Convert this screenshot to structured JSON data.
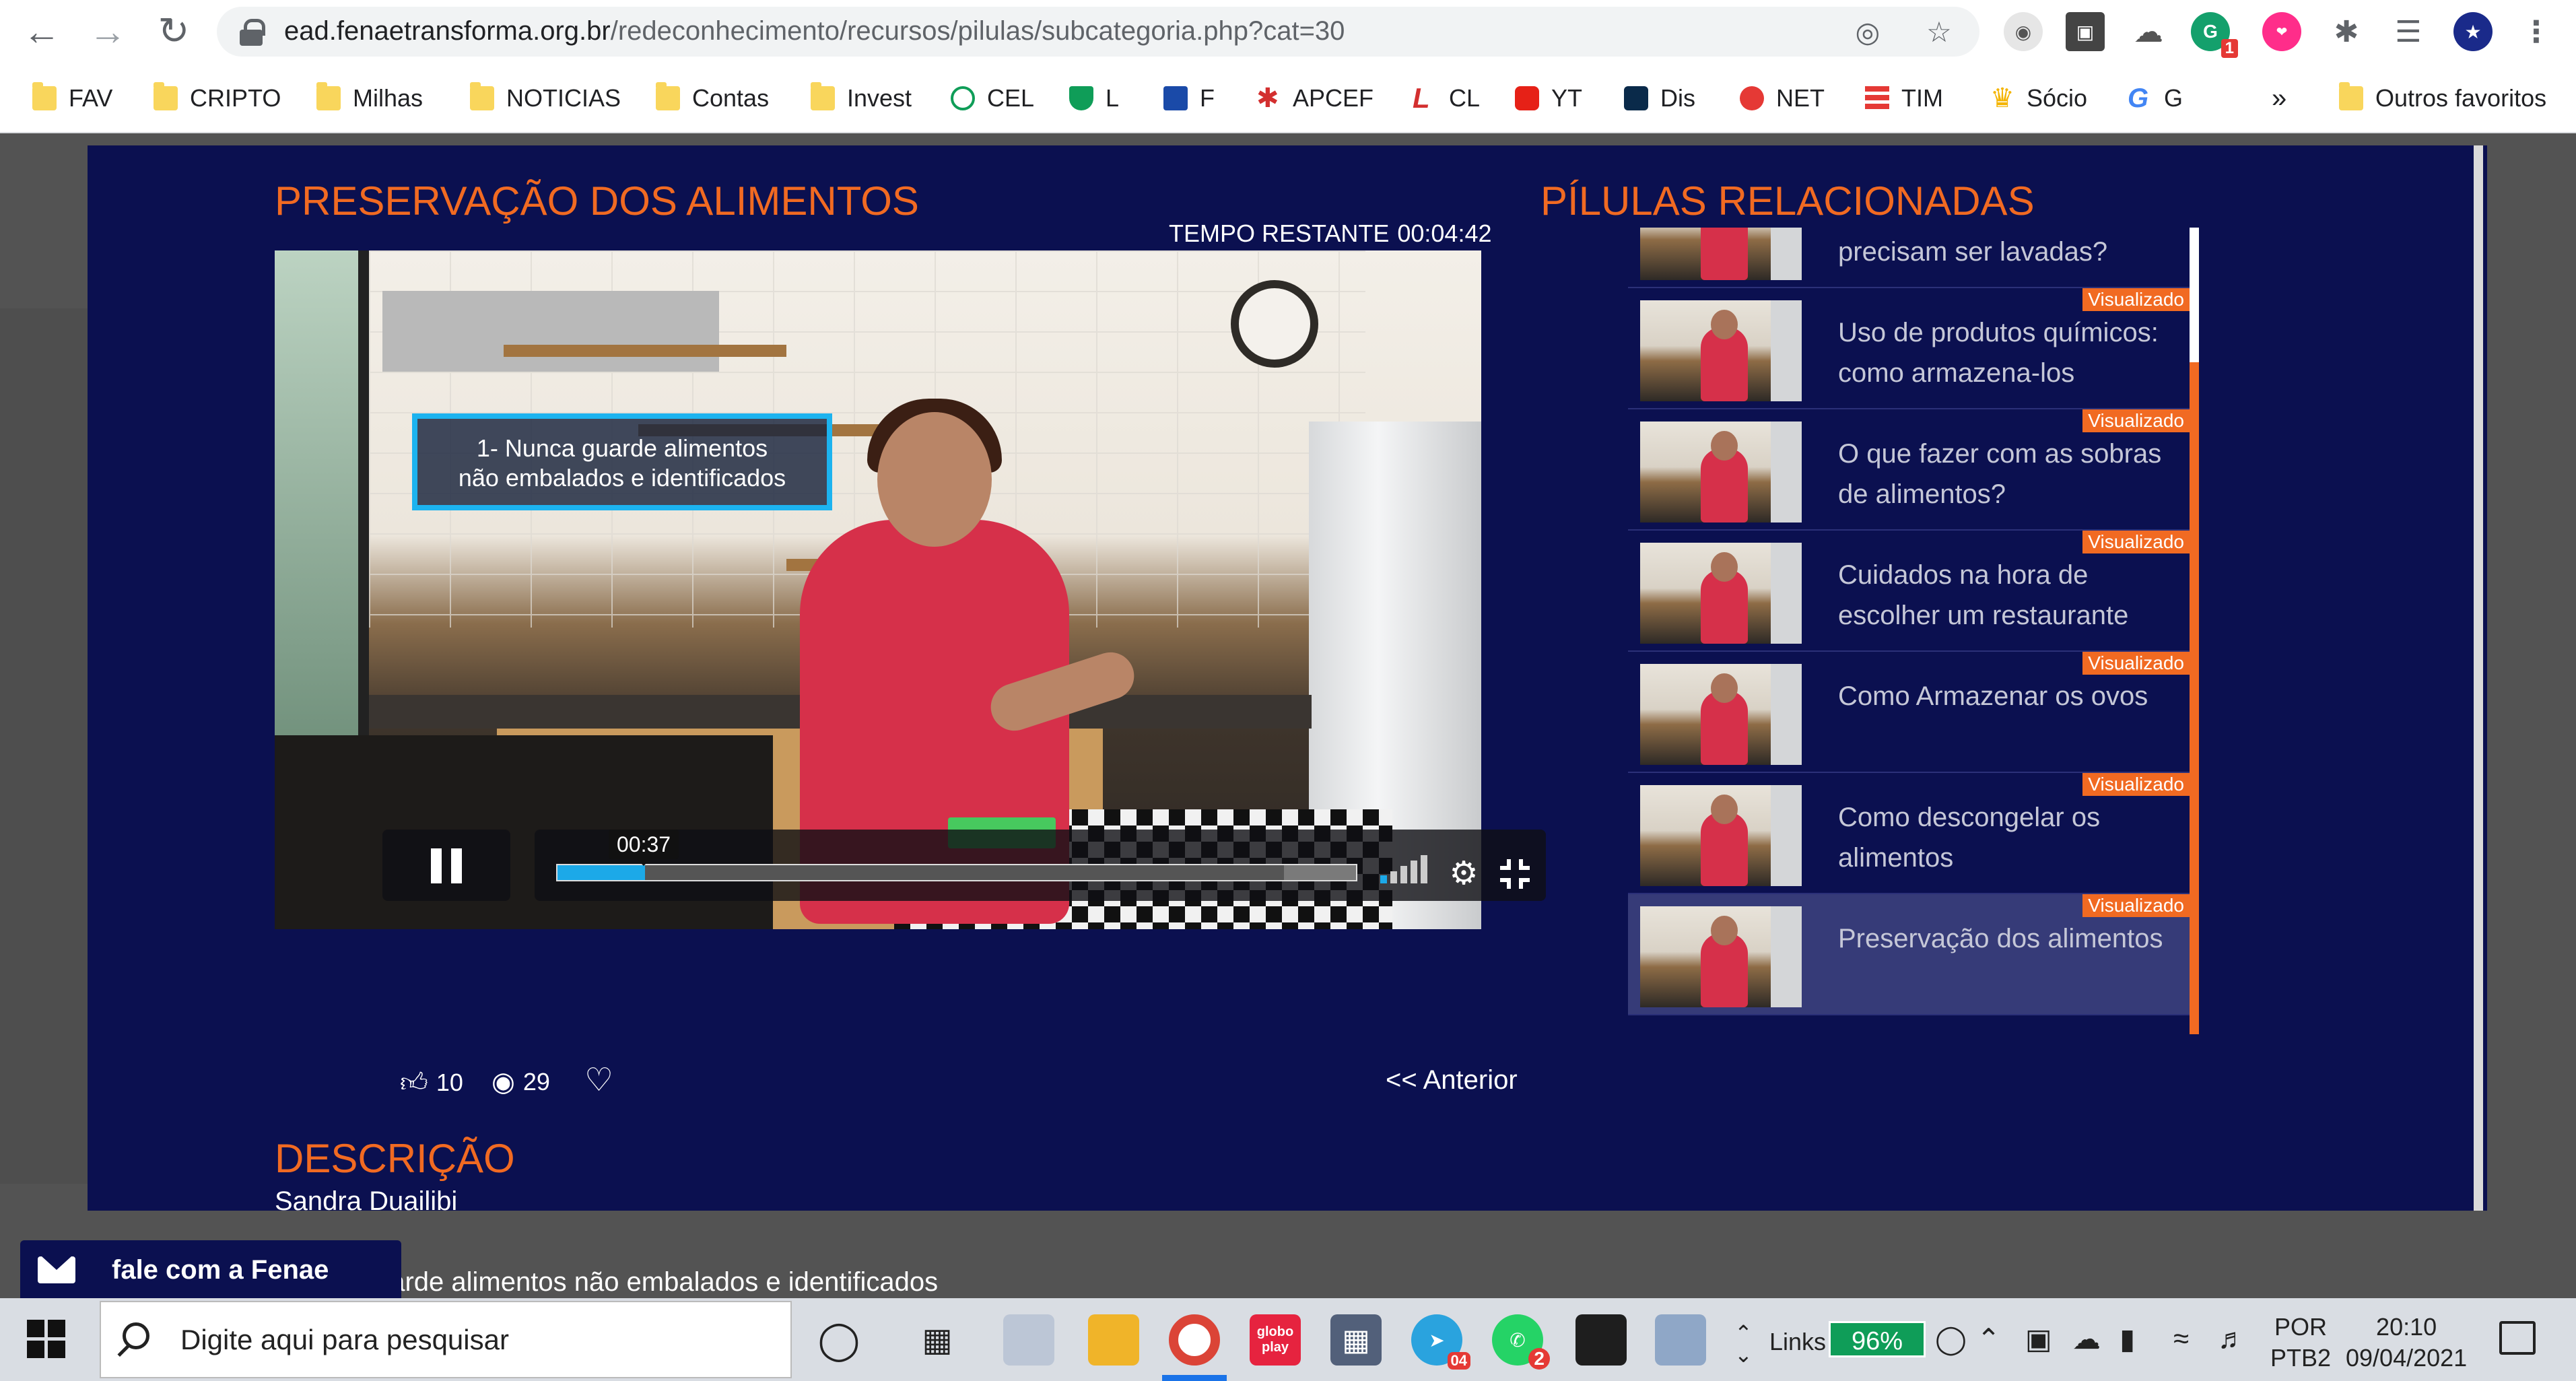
{
  "browser": {
    "url_domain": "ead.fenaetransforma.org.br",
    "url_path": "/redeconhecimento/recursos/pilulas/subcategoria.php?cat=30",
    "extension_badge": "1",
    "bookmarks": [
      {
        "label": "FAV",
        "icon": "folder"
      },
      {
        "label": "CRIPTO",
        "icon": "folder"
      },
      {
        "label": "Milhas",
        "icon": "folder"
      },
      {
        "label": "NOTICIAS",
        "icon": "folder"
      },
      {
        "label": "Contas",
        "icon": "folder"
      },
      {
        "label": "Invest",
        "icon": "folder"
      },
      {
        "label": "CEL",
        "icon": "cel-icon"
      },
      {
        "label": "L",
        "icon": "shield-icon"
      },
      {
        "label": "F",
        "icon": "funcef-icon"
      },
      {
        "label": "APCEF",
        "icon": "apcef-icon"
      },
      {
        "label": "CL",
        "icon": "cl-icon"
      },
      {
        "label": "YT",
        "icon": "youtube-icon"
      },
      {
        "label": "Dis",
        "icon": "disney-icon"
      },
      {
        "label": "NET",
        "icon": "claro-icon"
      },
      {
        "label": "TIM",
        "icon": "tim-icon"
      },
      {
        "label": "Sócio",
        "icon": "crown-icon"
      },
      {
        "label": "G",
        "icon": "google-icon"
      }
    ],
    "more_bookmarks": "»",
    "other_bookmarks": "Outros favoritos"
  },
  "lesson": {
    "title": "PRESERVAÇÃO DOS ALIMENTOS",
    "remaining_label": "TEMPO RESTANTE",
    "remaining_time": "00:04:42",
    "caption_line1": "1- Nunca guarde alimentos",
    "caption_line2": "não embalados e identificados",
    "current_time": "00:37",
    "progress": 0.11,
    "buffered": 0.91,
    "likes": "10",
    "views": "29",
    "previous_label": "<< Anterior",
    "description_title": "DESCRIÇÃO",
    "author": "Sandra Duailibi",
    "description": "Nunca guarde alimentos não embalados e identificados"
  },
  "related": {
    "title": "PÍLULAS RELACIONADAS",
    "badge": "Visualizado",
    "items": [
      {
        "label": "Folhas para salada precisam ser lavadas?",
        "viewed": false,
        "active": false
      },
      {
        "label": "Uso de produtos químicos: como armazena-los",
        "viewed": true,
        "active": false
      },
      {
        "label": "O que fazer com as sobras de alimentos?",
        "viewed": true,
        "active": false
      },
      {
        "label": "Cuidados na hora de escolher um restaurante",
        "viewed": true,
        "active": false
      },
      {
        "label": "Como Armazenar os ovos",
        "viewed": true,
        "active": false
      },
      {
        "label": "Como descongelar os alimentos",
        "viewed": true,
        "active": false
      },
      {
        "label": "Preservação dos alimentos",
        "viewed": true,
        "active": true
      }
    ]
  },
  "chat": {
    "label": "fale com a Fenae"
  },
  "taskbar": {
    "search_placeholder": "Digite aqui para pesquisar",
    "links_label": "Links",
    "battery": "96%",
    "lang_top": "POR",
    "lang_bottom": "PTB2",
    "time": "20:10",
    "date": "09/04/2021",
    "telegram_badge": "04",
    "whatsapp_badge": "2",
    "globoplay_label": "globo play"
  }
}
